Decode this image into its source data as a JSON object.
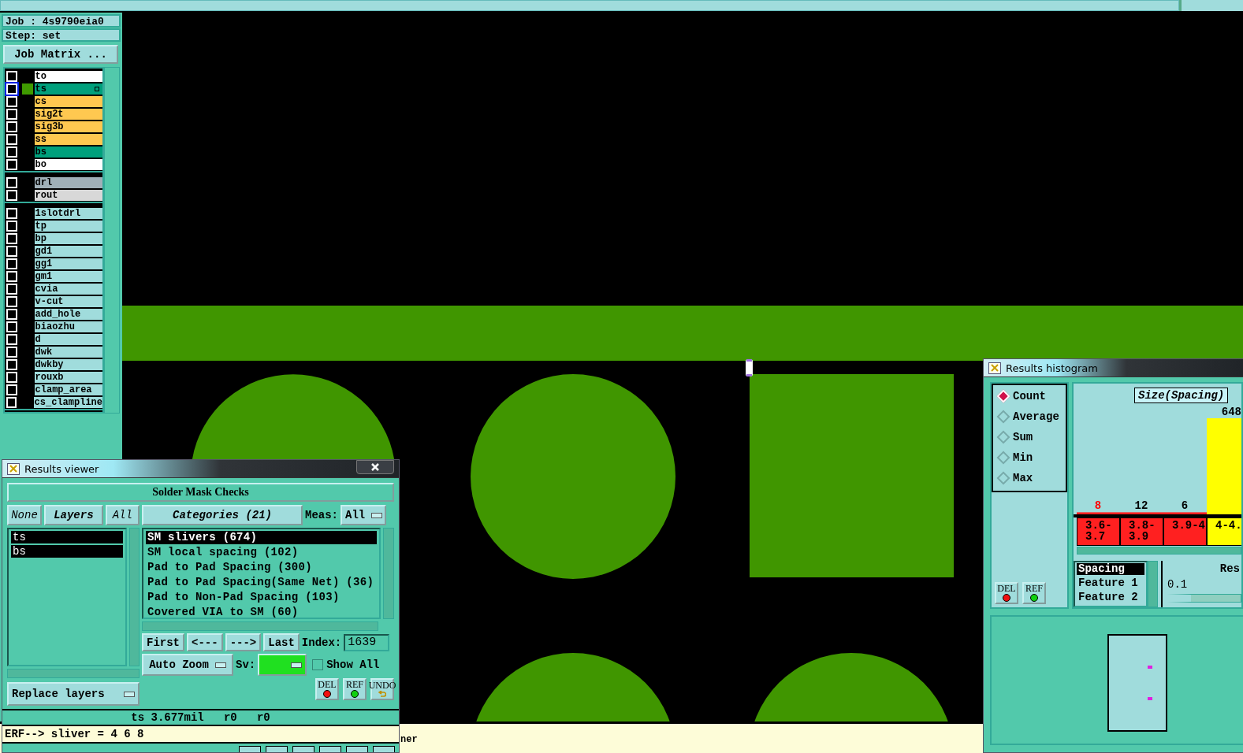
{
  "job_panel": {
    "job": "Job : 4s9790eia0",
    "step": "Step: set",
    "matrix_button": "Job Matrix ...",
    "layer_groups": [
      [
        {
          "name": "to",
          "color": "#ffffff",
          "checked": false,
          "work_layer": false
        },
        {
          "name": "ts",
          "color": "#00a07c",
          "checked": false,
          "work_layer": true
        },
        {
          "name": "cs",
          "color": "#ffc850",
          "checked": false,
          "work_layer": false
        },
        {
          "name": "sig2t",
          "color": "#ffc850",
          "checked": false,
          "work_layer": false
        },
        {
          "name": "sig3b",
          "color": "#ffc850",
          "checked": false,
          "work_layer": false
        },
        {
          "name": "ss",
          "color": "#ffc850",
          "checked": false,
          "work_layer": false
        },
        {
          "name": "bs",
          "color": "#00a07c",
          "checked": false,
          "work_layer": false
        },
        {
          "name": "bo",
          "color": "#ffffff",
          "checked": false,
          "work_layer": false
        }
      ],
      [
        {
          "name": "drl",
          "color": "#a0b0b8",
          "checked": false,
          "work_layer": false
        },
        {
          "name": "rout",
          "color": "#d8d8d8",
          "checked": false,
          "work_layer": false
        }
      ],
      [
        {
          "name": "1slotdrl",
          "color": "#a0dcdc",
          "checked": false,
          "work_layer": false
        },
        {
          "name": "tp",
          "color": "#a0dcdc",
          "checked": false,
          "work_layer": false
        },
        {
          "name": "bp",
          "color": "#a0dcdc",
          "checked": false,
          "work_layer": false
        },
        {
          "name": "gd1",
          "color": "#a0dcdc",
          "checked": false,
          "work_layer": false
        },
        {
          "name": "gg1",
          "color": "#a0dcdc",
          "checked": false,
          "work_layer": false
        },
        {
          "name": "gm1",
          "color": "#a0dcdc",
          "checked": false,
          "work_layer": false
        },
        {
          "name": "cvia",
          "color": "#a0dcdc",
          "checked": false,
          "work_layer": false
        },
        {
          "name": "v-cut",
          "color": "#a0dcdc",
          "checked": false,
          "work_layer": false
        },
        {
          "name": "add_hole",
          "color": "#a0dcdc",
          "checked": false,
          "work_layer": false
        },
        {
          "name": "biaozhu",
          "color": "#a0dcdc",
          "checked": false,
          "work_layer": false
        },
        {
          "name": "d",
          "color": "#a0dcdc",
          "checked": false,
          "work_layer": false
        },
        {
          "name": "dwk",
          "color": "#a0dcdc",
          "checked": false,
          "work_layer": false
        },
        {
          "name": "dwkby",
          "color": "#a0dcdc",
          "checked": false,
          "work_layer": false
        },
        {
          "name": "rouxb",
          "color": "#a0dcdc",
          "checked": false,
          "work_layer": false
        },
        {
          "name": "clamp_area",
          "color": "#a0dcdc",
          "checked": false,
          "work_layer": false
        },
        {
          "name": "cs_clampline",
          "color": "#a0dcdc",
          "checked": false,
          "work_layer": false
        }
      ]
    ]
  },
  "message_bar": {
    "text": "ner"
  },
  "results_viewer": {
    "title": "Results viewer",
    "heading": "Solder Mask Checks",
    "layer_buttons": [
      "None",
      "Layers",
      "All"
    ],
    "layers": [
      {
        "name": "ts",
        "selected": true
      },
      {
        "name": "bs",
        "selected": true
      }
    ],
    "categories_button": "Categories (21)",
    "meas_label": "Meas:",
    "meas_value": "All",
    "categories": [
      {
        "label": "SM slivers (674)",
        "selected": true
      },
      {
        "label": "SM local spacing (102)",
        "selected": false
      },
      {
        "label": "Pad to Pad Spacing (300)",
        "selected": false
      },
      {
        "label": "Pad to Pad Spacing(Same Net) (36)",
        "selected": false
      },
      {
        "label": "Pad to Non-Pad Spacing (103)",
        "selected": false
      },
      {
        "label": "Covered VIA to SM (60)",
        "selected": false
      }
    ],
    "nav_buttons": [
      "First",
      "<---",
      "--->",
      "Last"
    ],
    "index_label": "Index:",
    "index_value": "1639",
    "zoom_mode": "Auto Zoom",
    "sv_label": "Sv:",
    "show_all": {
      "label": "Show All",
      "checked": false
    },
    "action_buttons": [
      "DEL",
      "REF",
      "UNDO"
    ],
    "replace_mode": "Replace layers",
    "status": "ts 3.677mil   r0   r0",
    "erf_line": "ERF--> sliver = 4 6 8"
  },
  "histogram": {
    "title": "Results histogram",
    "modes": [
      {
        "label": "Count",
        "selected": true
      },
      {
        "label": "Average",
        "selected": false
      },
      {
        "label": "Sum",
        "selected": false
      },
      {
        "label": "Min",
        "selected": false
      },
      {
        "label": "Max",
        "selected": false
      }
    ],
    "buttons": [
      "DEL",
      "REF"
    ],
    "chart_data": {
      "type": "bar",
      "title": "Size(Spacing)",
      "categories": [
        "3.6-3.7",
        "3.8-3.9",
        "3.9-4",
        "4-4."
      ],
      "values": [
        8,
        12,
        6,
        648
      ],
      "value_labels": [
        "8",
        "12",
        "6",
        "648"
      ]
    },
    "bins": [
      {
        "color": "#ff2020",
        "selected": true
      },
      {
        "color": "#ff2020",
        "selected": false
      },
      {
        "color": "#ff2020",
        "selected": false
      },
      {
        "color": "#ffff00",
        "selected": false
      }
    ],
    "attributes": [
      {
        "label": "Spacing",
        "selected": true
      },
      {
        "label": "Feature 1",
        "selected": false
      },
      {
        "label": "Feature 2",
        "selected": false
      }
    ],
    "resolution_label": "Res",
    "resolution_value": "0.1"
  }
}
